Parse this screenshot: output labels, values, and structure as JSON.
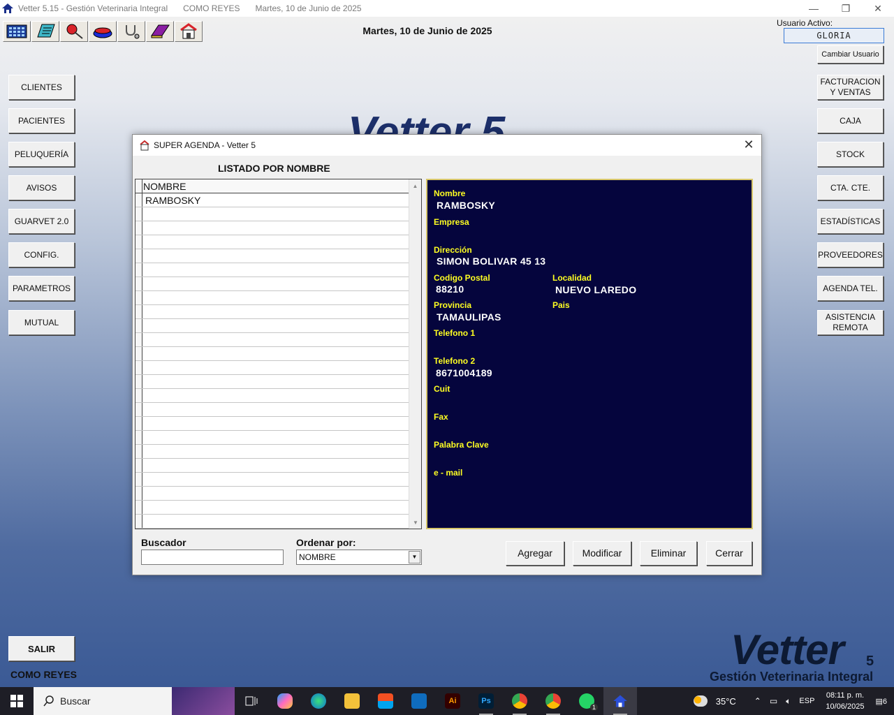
{
  "window": {
    "title_segments": [
      "Vetter 5.15 - Gestión Veterinaria Integral",
      "COMO REYES",
      "Martes, 10 de Junio de 2025"
    ],
    "controls": {
      "minimize": "—",
      "restore": "❐",
      "close": "✕"
    }
  },
  "header": {
    "date": "Martes, 10 de Junio de 2025",
    "user_label": "Usuario Activo:",
    "user_value": "GLORIA",
    "change_user": "Cambiar Usuario"
  },
  "toolbar": {
    "icons": [
      "calculator-icon",
      "notebook-icon",
      "pin-icon",
      "bowl-icon",
      "stethoscope-icon",
      "book-icon",
      "vet-house-icon"
    ]
  },
  "left_menu": [
    "CLIENTES",
    "PACIENTES",
    "PELUQUERÍA",
    "AVISOS",
    "GUARVET 2.0",
    "CONFIG.",
    "PARAMETROS",
    "MUTUAL"
  ],
  "right_menu": [
    "FACTURACION\nY VENTAS",
    "CAJA",
    "STOCK",
    "CTA. CTE.",
    "ESTADÍSTICAS",
    "PROVEEDORES",
    "AGENDA TEL.",
    "ASISTENCIA\nREMOTA"
  ],
  "exit_button": "SALIR",
  "company": "COMO REYES",
  "logo": {
    "name": "Vetter",
    "version": "5",
    "subtitle": "Gestión Veterinaria Integral"
  },
  "dialog": {
    "title": "SUPER AGENDA -  Vetter 5",
    "close": "✕",
    "list_heading": "LISTADO POR NOMBRE",
    "grid": {
      "header": "NOMBRE",
      "rows": [
        "RAMBOSKY"
      ]
    },
    "details": {
      "nombre_label": "Nombre",
      "nombre": "RAMBOSKY",
      "empresa_label": "Empresa",
      "direccion_label": "Dirección",
      "direccion": "SIMON BOLIVAR 45 13",
      "cp_label": "Codigo Postal",
      "cp": "88210",
      "localidad_label": "Localidad",
      "localidad": "NUEVO LAREDO",
      "provincia_label": "Provincia",
      "provincia": "TAMAULIPAS",
      "pais_label": "Pais",
      "tel1_label": "Telefono 1",
      "tel2_label": "Telefono 2",
      "tel2": "8671004189",
      "cuit_label": "Cuit",
      "fax_label": "Fax",
      "clave_label": "Palabra Clave",
      "email_label": "e - mail"
    },
    "buscador_label": "Buscador",
    "buscador_value": "",
    "ordenar_label": "Ordenar por:",
    "ordenar_value": "NOMBRE",
    "buttons": {
      "agregar": "Agregar",
      "modificar": "Modificar",
      "eliminar": "Eliminar",
      "cerrar": "Cerrar"
    }
  },
  "taskbar": {
    "search_placeholder": "Buscar",
    "temperature": "35°C",
    "language": "ESP",
    "time": "08:11 p. m.",
    "date": "10/06/2025",
    "notifications": "6",
    "whatsapp_badge": "1"
  }
}
